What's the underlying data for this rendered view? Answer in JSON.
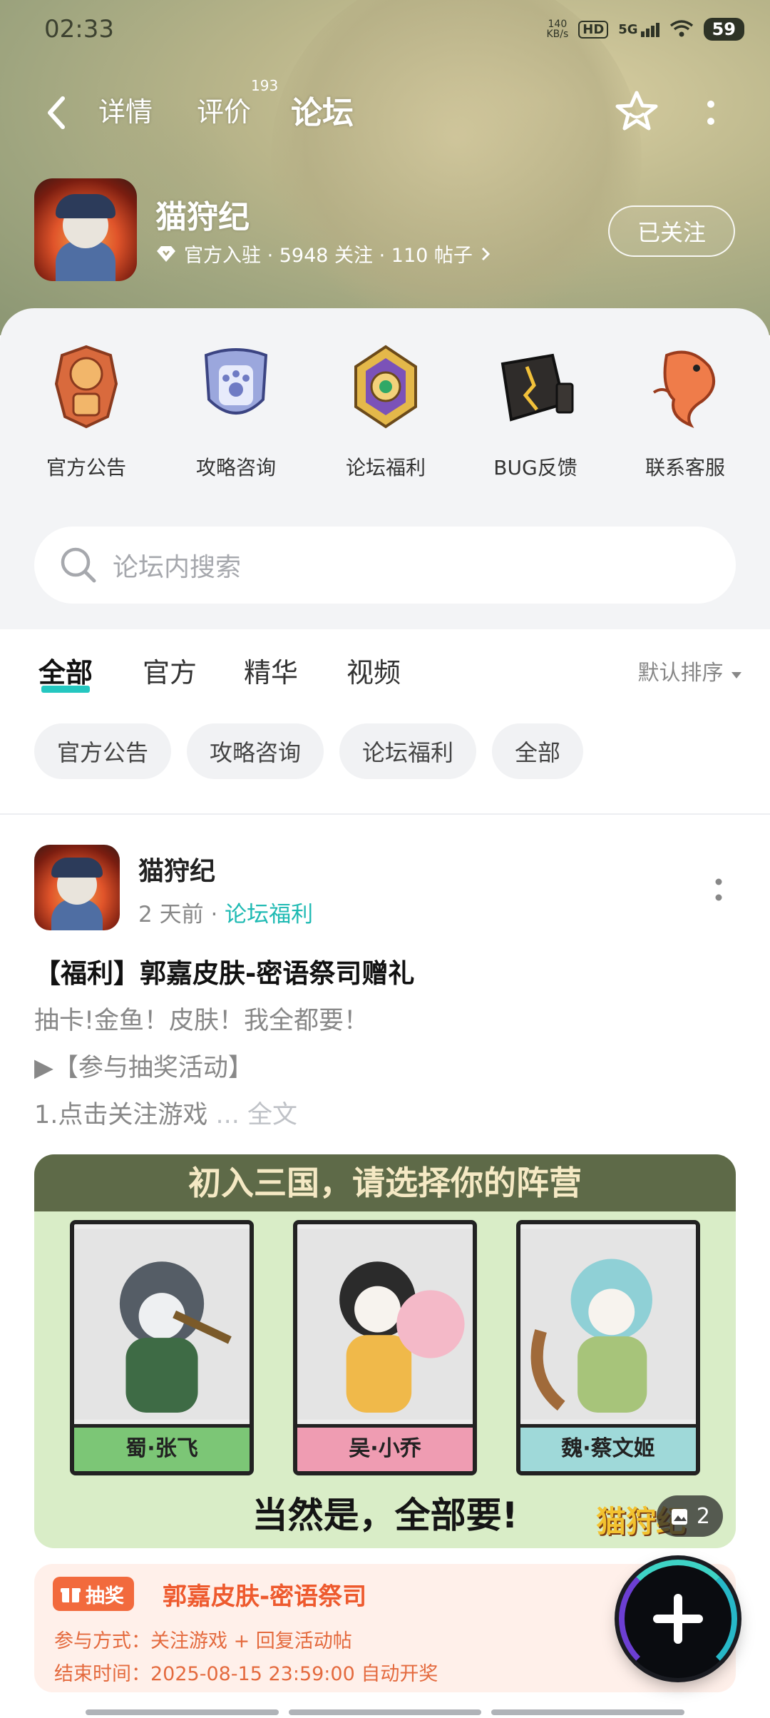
{
  "status_bar": {
    "time": "02:33",
    "net_speed": "140\nKB/s",
    "hd": "HD",
    "signal": "5G",
    "battery": "59"
  },
  "nav": {
    "tabs": [
      {
        "label": "详情"
      },
      {
        "label": "评价",
        "badge": "193"
      },
      {
        "label": "论坛"
      }
    ],
    "active_tab": "论坛"
  },
  "game": {
    "name": "猫狩纪",
    "meta": "官方入驻 · 5948 关注 · 110 帖子",
    "follow_label": "已关注"
  },
  "categories": [
    {
      "label": "官方公告",
      "icon": "announcement-badge-icon"
    },
    {
      "label": "攻略咨询",
      "icon": "paw-shield-icon"
    },
    {
      "label": "论坛福利",
      "icon": "gold-medal-icon"
    },
    {
      "label": "BUG反馈",
      "icon": "broken-cube-icon"
    },
    {
      "label": "联系客服",
      "icon": "koi-fish-icon"
    }
  ],
  "search": {
    "placeholder": "论坛内搜索"
  },
  "feed_tabs": [
    {
      "label": "全部"
    },
    {
      "label": "官方"
    },
    {
      "label": "精华"
    },
    {
      "label": "视频"
    }
  ],
  "sort_label": "默认排序",
  "filters": [
    {
      "label": "官方公告"
    },
    {
      "label": "攻略咨询"
    },
    {
      "label": "论坛福利"
    },
    {
      "label": "全部"
    }
  ],
  "post": {
    "author": "猫狩纪",
    "time": "2 天前",
    "category": "论坛福利",
    "title": "【福利】郭嘉皮肤-密语祭司赠礼",
    "line1": "抽卡!金鱼！皮肤！我全都要！",
    "line2": "▶【参与抽奖活动】",
    "line3": "1.点击关注游戏",
    "ellipsis": " ... ",
    "full_text": "全文",
    "banner": {
      "headline": "初入三国，请选择你的阵营",
      "cards": [
        {
          "label": "蜀·张飞"
        },
        {
          "label": "吴·小乔"
        },
        {
          "label": "魏·蔡文姬"
        }
      ],
      "bottom_text": "当然是，全部要!",
      "image_count": "2",
      "watermark": "猫狩纪"
    },
    "lottery": {
      "badge": "抽奖",
      "title": "郭嘉皮肤-密语祭司",
      "method": "参与方式：关注游戏 + 回复活动帖",
      "end_time": "结束时间：2025-08-15 23:59:00 自动开奖"
    }
  },
  "colors": {
    "accent": "#24c7c0",
    "lottery": "#ee5a2e"
  }
}
